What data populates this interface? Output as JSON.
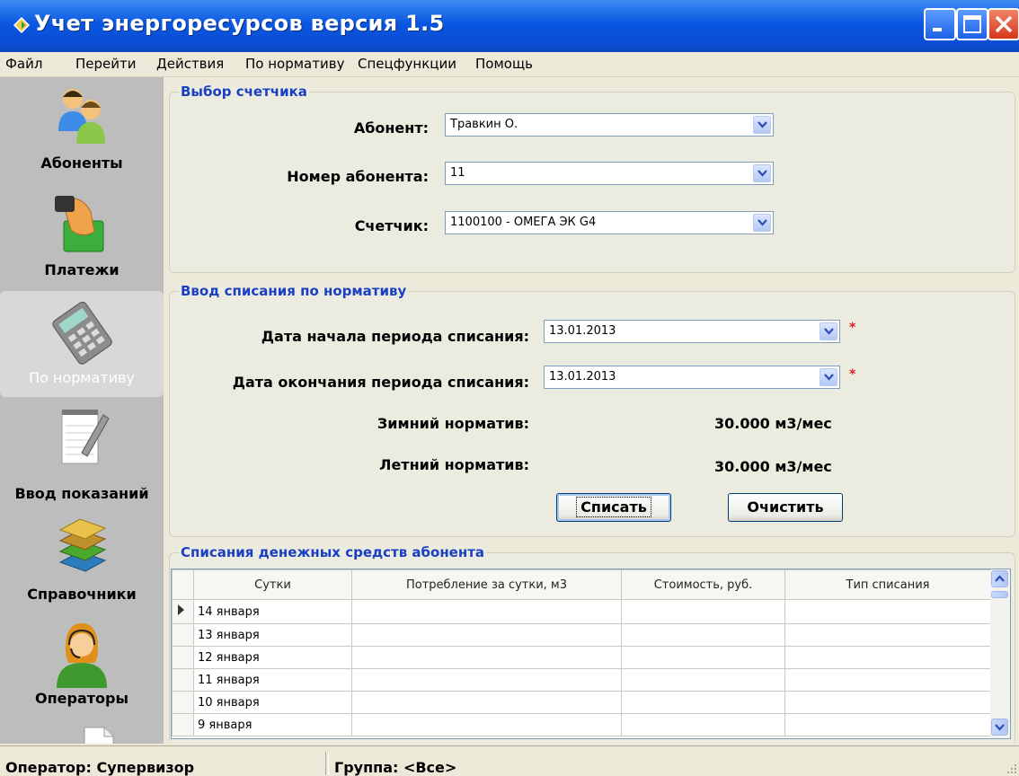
{
  "window": {
    "title": "Учет энергоресурсов версия 1.5"
  },
  "menu": [
    "Файл",
    "Перейти",
    "Действия",
    "По нормативу",
    "Спецфункции",
    "Помощь"
  ],
  "sidebar": {
    "items": [
      {
        "label": "Абоненты",
        "icon": "users-icon"
      },
      {
        "label": "Платежи",
        "icon": "payment-hand-icon"
      },
      {
        "label": "По нормативу",
        "icon": "calculator-icon",
        "active": true
      },
      {
        "label": "Ввод показаний",
        "icon": "notepad-pen-icon"
      },
      {
        "label": "Справочники",
        "icon": "books-icon"
      },
      {
        "label": "Операторы",
        "icon": "operator-headset-icon"
      }
    ]
  },
  "meter_select": {
    "legend": "Выбор счетчика",
    "subscriber_label": "Абонент:",
    "subscriber_value": "Травкин О.",
    "number_label": "Номер абонента:",
    "number_value": "11",
    "meter_label": "Счетчик:",
    "meter_value": "1100100 - ОМЕГА ЭК G4"
  },
  "writeoff": {
    "legend": "Ввод списания по нормативу",
    "start_label": "Дата начала периода списания:",
    "start_value": "13.01.2013",
    "end_label": "Дата окончания периода списания:",
    "end_value": "13.01.2013",
    "required_mark": "*",
    "winter_label": "Зимний норматив:",
    "winter_value": "30.000 м3/мес",
    "summer_label": "Летний норматив:",
    "summer_value": "30.000 м3/мес",
    "writeoff_button": "Списать",
    "clear_button": "Очистить"
  },
  "history": {
    "legend": "Списания денежных средств абонента",
    "columns": [
      "Сутки",
      "Потребление за сутки, м3",
      "Стоимость, руб.",
      "Тип списания"
    ],
    "rows": [
      [
        "14 января",
        "",
        "",
        ""
      ],
      [
        "13 января",
        "",
        "",
        ""
      ],
      [
        "12 января",
        "",
        "",
        ""
      ],
      [
        "11 января",
        "",
        "",
        ""
      ],
      [
        "10 января",
        "",
        "",
        ""
      ],
      [
        "9 января",
        "",
        "",
        ""
      ]
    ]
  },
  "status": {
    "operator": "Оператор: Супервизор",
    "group": "Группа: <Все>"
  },
  "colors": {
    "title_bar": "#0a56e0",
    "legend_text": "#1a3fc2",
    "sidebar_bg": "#bdbdbd",
    "window_bg": "#ece9d8"
  }
}
